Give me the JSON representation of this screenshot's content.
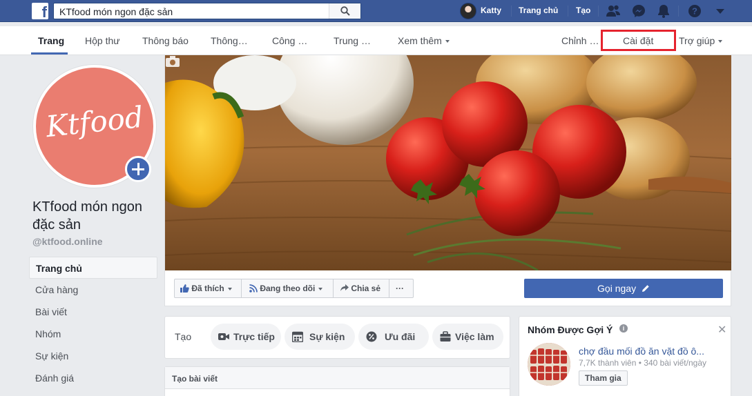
{
  "topbar": {
    "logo": "f",
    "search_value": "KTfood món ngon đặc sản",
    "user_name": "Katty",
    "home": "Trang chủ",
    "create": "Tạo",
    "icons": [
      "friends-icon",
      "messenger-icon",
      "notifications-icon",
      "help-icon",
      "account-menu-icon"
    ]
  },
  "tabs": {
    "items": [
      "Trang",
      "Hộp thư",
      "Thông báo",
      "Thông…",
      "Công …",
      "Trung …",
      "Xem thêm"
    ],
    "right": [
      "Chỉnh …",
      "Cài đặt",
      "Trợ giúp"
    ]
  },
  "page": {
    "logo_text": "Ktfood",
    "name": "KTfood món ngon đặc sản",
    "handle": "@ktfood.online"
  },
  "left_menu": [
    "Trang chủ",
    "Cửa hàng",
    "Bài viết",
    "Nhóm",
    "Sự kiện",
    "Đánh giá"
  ],
  "actions": {
    "like": "Đã thích",
    "follow": "Đang theo dõi",
    "share": "Chia sẻ",
    "more": "···",
    "call": "Gọi ngay"
  },
  "create_bar": {
    "label": "Tạo",
    "items": [
      "Trực tiếp",
      "Sự kiện",
      "Ưu đãi",
      "Việc làm"
    ]
  },
  "post": {
    "title": "Tạo bài viết"
  },
  "suggested_groups": {
    "title": "Nhóm Được Gợi Ý",
    "group_name": "chợ đầu mối đồ ăn vặt đồ ô...",
    "group_meta": "7,7K thành viên • 340 bài viết/ngày",
    "join": "Tham gia"
  },
  "colors": {
    "facebook_blue": "#3b5998",
    "button_blue": "#4267b2",
    "highlight_red": "#e5232e",
    "logo_bg": "#ea7d70"
  }
}
